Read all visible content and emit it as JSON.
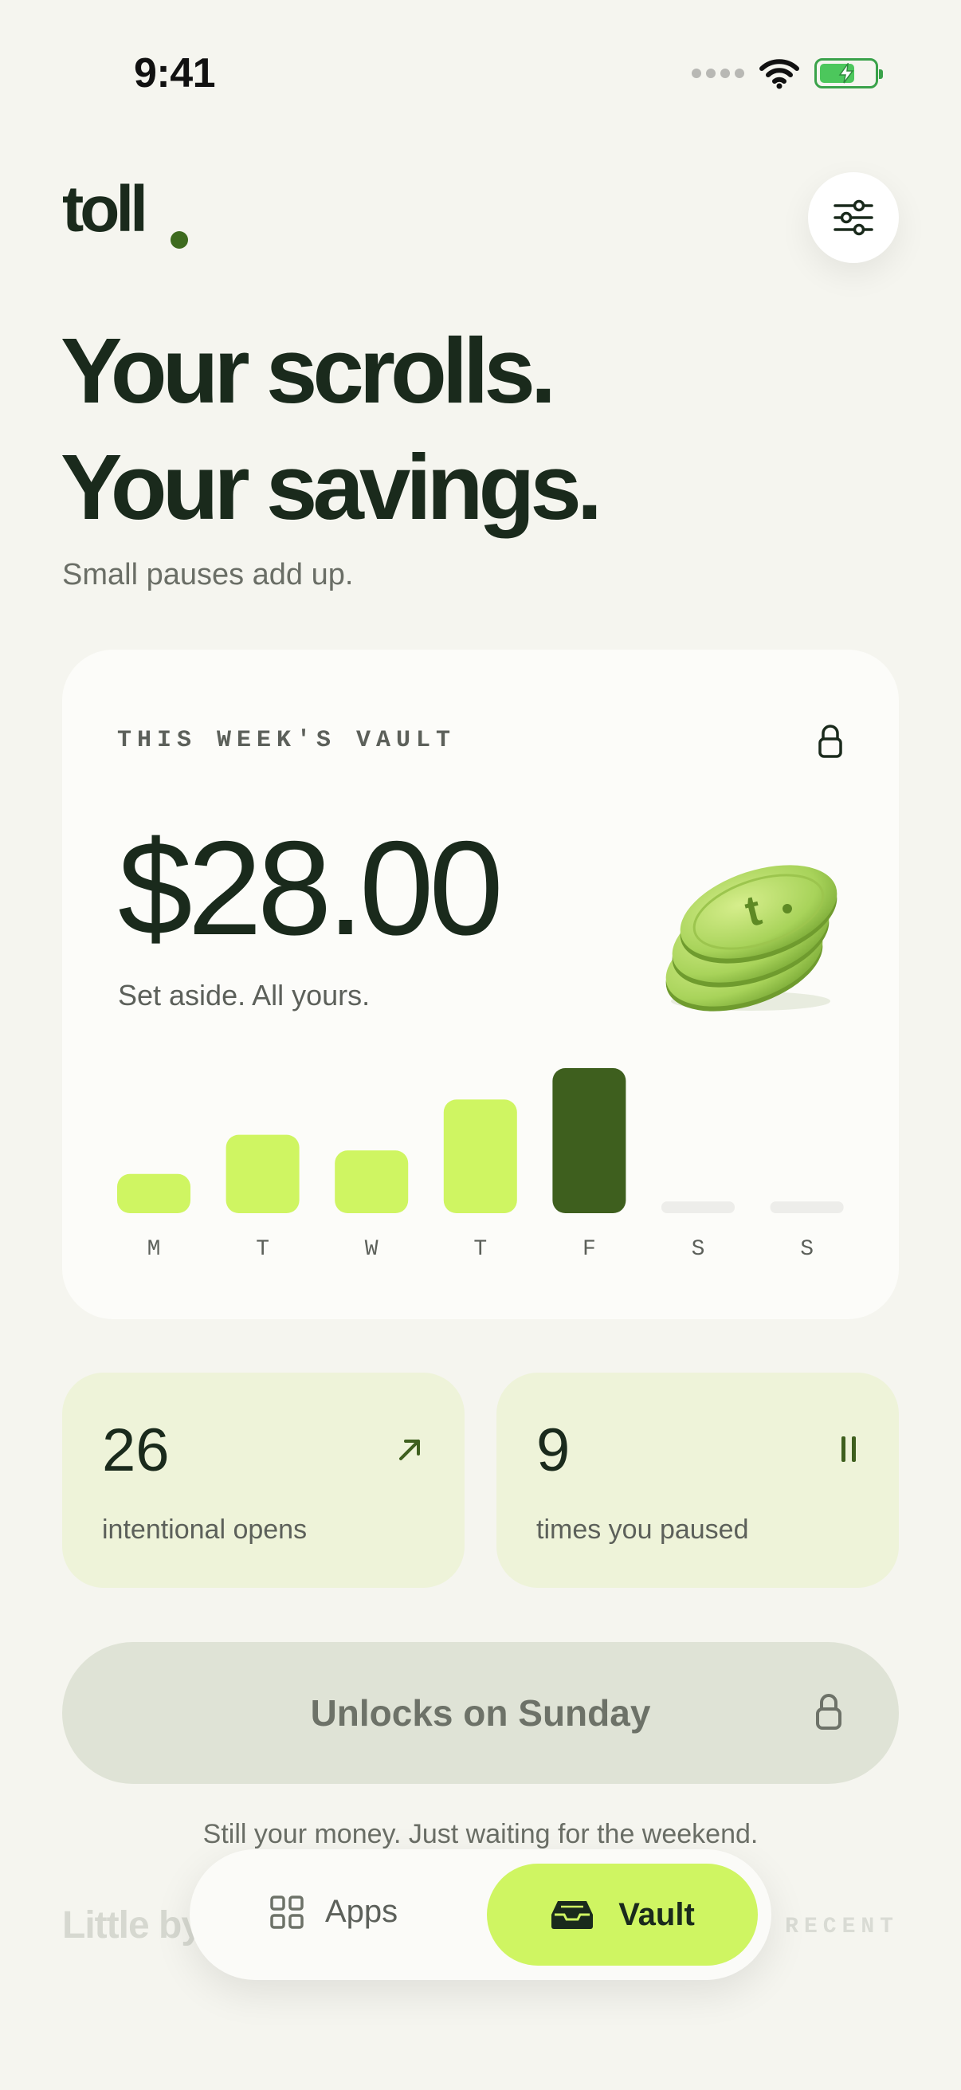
{
  "status_bar": {
    "time": "9:41",
    "battery_level": 0.65
  },
  "app": {
    "logo": "toll"
  },
  "hero": {
    "headline_line1": "Your scrolls.",
    "headline_line2": "Your savings.",
    "subtitle": "Small pauses add up."
  },
  "vault": {
    "label": "THIS WEEK'S VAULT",
    "amount": "$28.00",
    "caption": "Set aside. All yours."
  },
  "chart_data": {
    "type": "bar",
    "categories": [
      "M",
      "T",
      "W",
      "T",
      "F",
      "S",
      "S"
    ],
    "values": [
      2,
      4,
      3.2,
      5.8,
      7.4,
      0.6,
      0.6
    ],
    "ylim": [
      0,
      7.4
    ],
    "highlight_index": 4,
    "colors": {
      "default": "#cff562",
      "highlight": "#3e5f1e",
      "empty": "#ededea"
    },
    "grid": false,
    "title": "",
    "xlabel": "",
    "ylabel": ""
  },
  "stats": [
    {
      "value": "26",
      "label": "intentional opens",
      "icon": "arrow-up-right-icon"
    },
    {
      "value": "9",
      "label": "times you paused",
      "icon": "pause-icon"
    }
  ],
  "unlock": {
    "label": "Unlocks on Sunday"
  },
  "note": "Still your money. Just waiting for the weekend.",
  "section": {
    "title": "Little by little",
    "tag": "RECENT"
  },
  "tabbar": {
    "tabs": [
      {
        "label": "Apps",
        "icon": "grid-icon",
        "active": false
      },
      {
        "label": "Vault",
        "icon": "inbox-icon",
        "active": true
      }
    ]
  },
  "colors": {
    "accent": "#cff562",
    "dark_green": "#3e5f1e",
    "background": "#f5f5ef",
    "stat_card": "#eef3d9"
  }
}
